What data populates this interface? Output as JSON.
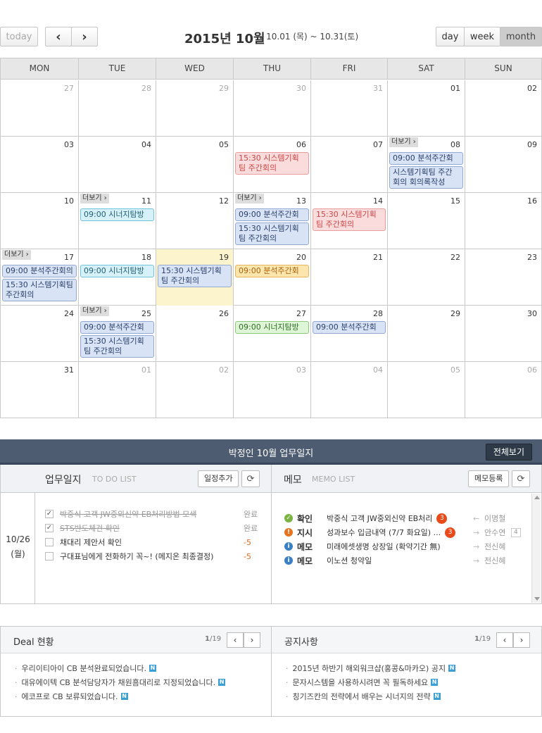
{
  "toolbar": {
    "today_label": "today",
    "prev_label": "‹",
    "next_label": "›",
    "month_title": "2015년 10월",
    "range": "- 10.01 (목) ~ 10.31(토)",
    "view_day": "day",
    "view_week": "week",
    "view_month": "month",
    "active_view": "month"
  },
  "weekdays": [
    "MON",
    "TUE",
    "WED",
    "THU",
    "FRI",
    "SAT",
    "SUN"
  ],
  "weeks": [
    {
      "days": [
        {
          "d": "27",
          "muted": true
        },
        {
          "d": "28",
          "muted": true
        },
        {
          "d": "29",
          "muted": true
        },
        {
          "d": "30",
          "muted": true
        },
        {
          "d": "31",
          "muted": true
        },
        {
          "d": "01"
        },
        {
          "d": "02"
        }
      ]
    },
    {
      "days": [
        {
          "d": "03"
        },
        {
          "d": "04"
        },
        {
          "d": "05"
        },
        {
          "d": "06"
        },
        {
          "d": "07"
        },
        {
          "d": "08",
          "more": "더보기 ›"
        },
        {
          "d": "09"
        }
      ]
    },
    {
      "days": [
        {
          "d": "10"
        },
        {
          "d": "11",
          "more": "더보기 ›"
        },
        {
          "d": "12"
        },
        {
          "d": "13",
          "more": "더보기 ›"
        },
        {
          "d": "14"
        },
        {
          "d": "15"
        },
        {
          "d": "16"
        }
      ]
    },
    {
      "days": [
        {
          "d": "17",
          "more": "더보기 ›"
        },
        {
          "d": "18"
        },
        {
          "d": "19",
          "today": true
        },
        {
          "d": "20"
        },
        {
          "d": "21"
        },
        {
          "d": "22"
        },
        {
          "d": "23"
        }
      ]
    },
    {
      "days": [
        {
          "d": "24"
        },
        {
          "d": "25",
          "more": "더보기 ›"
        },
        {
          "d": "26"
        },
        {
          "d": "27"
        },
        {
          "d": "28"
        },
        {
          "d": "29"
        },
        {
          "d": "30"
        }
      ]
    },
    {
      "days": [
        {
          "d": "31"
        },
        {
          "d": "01",
          "muted": true
        },
        {
          "d": "02",
          "muted": true
        },
        {
          "d": "03",
          "muted": true
        },
        {
          "d": "04",
          "muted": true
        },
        {
          "d": "05",
          "muted": true
        },
        {
          "d": "06",
          "muted": true
        }
      ]
    }
  ],
  "events": [
    {
      "w": 1,
      "c": 3,
      "slot": 0,
      "lines": 2,
      "color": "red",
      "text": "15:30 시스템기획팀 주간회의"
    },
    {
      "w": 1,
      "c": 5,
      "slot": 0,
      "lines": 1,
      "color": "blue",
      "text": "09:00 분석주간회의"
    },
    {
      "w": 1,
      "c": 5,
      "slot": 1,
      "lines": 2,
      "color": "blue",
      "text": "시스템기획팀 주간 회의 회의록작성"
    },
    {
      "w": 2,
      "c": 1,
      "slot": 0,
      "lines": 1,
      "color": "cyan",
      "text": "09:00 시너지탐방"
    },
    {
      "w": 2,
      "c": 3,
      "slot": 0,
      "lines": 1,
      "color": "blue",
      "text": "09:00 분석주간회의"
    },
    {
      "w": 2,
      "c": 3,
      "slot": 1,
      "lines": 2,
      "color": "blue",
      "text": "15:30 시스템기획팀 주간회의"
    },
    {
      "w": 2,
      "c": 4,
      "slot": 0,
      "lines": 2,
      "color": "red",
      "text": "15:30 시스템기획팀 주간회의"
    },
    {
      "w": 3,
      "c": 0,
      "slot": 0,
      "lines": 1,
      "color": "blue",
      "text": "09:00 분석주간회의"
    },
    {
      "w": 3,
      "c": 0,
      "slot": 1,
      "lines": 2,
      "color": "blue",
      "text": "15:30 시스템기획팀 주간회의"
    },
    {
      "w": 3,
      "c": 1,
      "slot": 0,
      "lines": 1,
      "color": "cyan",
      "text": "09:00 시너지탐방"
    },
    {
      "w": 3,
      "c": 2,
      "slot": 0,
      "lines": 2,
      "color": "blue",
      "text": "15:30 시스템기획팀 주간회의"
    },
    {
      "w": 3,
      "c": 3,
      "slot": 0,
      "lines": 1,
      "color": "orange",
      "text": "09:00 분석주간회의"
    },
    {
      "w": 4,
      "c": 1,
      "slot": 0,
      "lines": 1,
      "color": "blue",
      "text": "09:00 분석주간회의"
    },
    {
      "w": 4,
      "c": 1,
      "slot": 1,
      "lines": 2,
      "color": "blue",
      "text": "15:30 시스템기획팀 주간회의"
    },
    {
      "w": 4,
      "c": 3,
      "slot": 0,
      "lines": 1,
      "color": "green",
      "text": "09:00 시너지탐방"
    },
    {
      "w": 4,
      "c": 4,
      "slot": 0,
      "lines": 1,
      "color": "blue",
      "text": "09:00 분석주간회의"
    }
  ],
  "journal": {
    "title": "박정인 10월 업무일지",
    "view_all": "전체보기",
    "todo_title": "업무일지",
    "todo_sub": "TO DO LIST",
    "add_schedule": "일정추가",
    "date": "10/26",
    "weekday": "(월)",
    "todos": [
      {
        "text": "박중식 고객 JW중외신약 EB처리방법 모색",
        "status": "완료",
        "done": true
      },
      {
        "text": "STS반도체건 확인",
        "status": "완료",
        "done": true
      },
      {
        "text": "채대리 제안서 확인",
        "status": "-5",
        "done": false
      },
      {
        "text": "구대표님에게 전화하기 꼭~! (메지온 최종결정)",
        "status": "-5",
        "done": false
      }
    ],
    "memo_title": "메모",
    "memo_sub": "MEMO LIST",
    "memo_add": "메모등록",
    "memos": [
      {
        "icon": "check",
        "color": "#7ab342",
        "kind": "확인",
        "text": "박중식 고객 JW중외신약 EB처리",
        "count": "3",
        "arrow": "←",
        "person": "이명철",
        "tag": ""
      },
      {
        "icon": "alert",
        "color": "#e8731f",
        "kind": "지시",
        "text": "성과보수 입금내역 (7/7 화요일) ...",
        "count": "3",
        "arrow": "→",
        "person": "안수연",
        "tag": "4"
      },
      {
        "icon": "info",
        "color": "#3b7fc4",
        "kind": "메모",
        "text": "미래에셋생명 상장일 (확약기간 無)",
        "count": "",
        "arrow": "→",
        "person": "전신혜",
        "tag": ""
      },
      {
        "icon": "info",
        "color": "#3b7fc4",
        "kind": "메모",
        "text": "이노션 청약일",
        "count": "",
        "arrow": "→",
        "person": "전신혜",
        "tag": ""
      }
    ]
  },
  "deal": {
    "title": "Deal 현황",
    "page": "1",
    "total": "/19",
    "items": [
      "우리이티아이 CB 분석완료되었습니다.",
      "대유에이텍 CB 분석담당자가 채원흠대리로 지정되었습니다.",
      "에코프로 CB 보류되었습니다."
    ]
  },
  "notice": {
    "title": "공지사항",
    "page": "1",
    "total": "/19",
    "items": [
      "2015년 하반기 해외워크샵(홍콩&마카오) 공지",
      "문자시스템을 사용하시려면 꼭 필독하세요",
      "칭기즈칸의 전략에서 배우는 시너지의 전략"
    ]
  },
  "new_badge": "N",
  "colors": {
    "banner": "#4d5c70",
    "today": "#fcf4cd"
  }
}
